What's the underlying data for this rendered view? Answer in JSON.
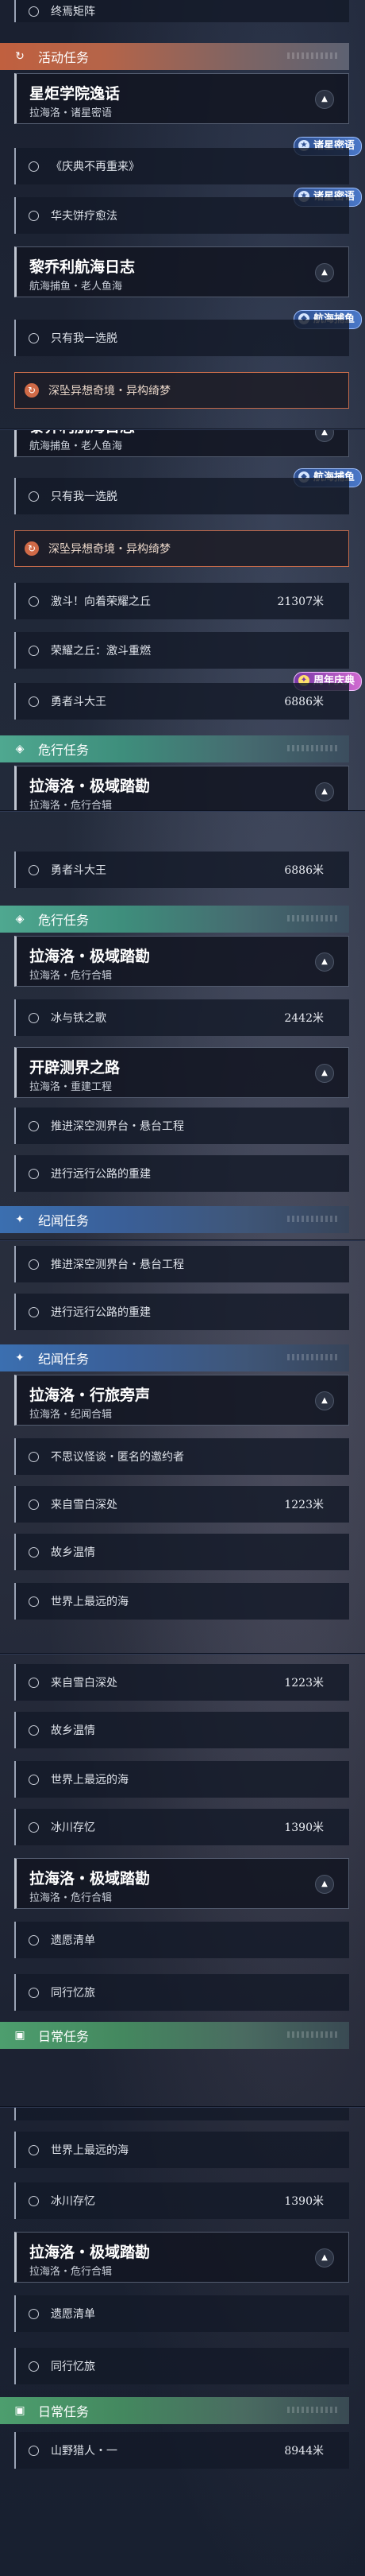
{
  "sections": {
    "activity": "活动任务",
    "danger": "危行任务",
    "chronicle": "纪闻任务",
    "daily": "日常任务"
  },
  "quests": {
    "top_partial": "终焉矩阵",
    "xingju": {
      "title": "星炬学院逸话",
      "subtitle": "拉海洛・诸星密语"
    },
    "qingdian": "《庆典不再重来》",
    "huafu": "华夫饼疗愈法",
    "liqiao": {
      "title": "黎乔利航海日志",
      "subtitle": "航海捕鱼・老人鱼海"
    },
    "zhiyou": "只有我一选脱",
    "shenzhui": "深坠异想奇境・异构绮梦",
    "jidou": "激斗！向着荣耀之丘",
    "rongyao": "荣耀之丘：激斗重燃",
    "yongzhe": "勇者斗大王",
    "jiyu": {
      "title": "拉海洛・极域踏勘",
      "subtitle": "拉海洛・危行合辑"
    },
    "bingyutie": "冰与铁之歌",
    "kaipi": {
      "title": "开辟测界之路",
      "subtitle": "拉海洛・重建工程"
    },
    "tuijin": "推进深空测界台・悬台工程",
    "jinxing": "进行远行公路的重建",
    "xinglv": {
      "title": "拉海洛・行旅旁声",
      "subtitle": "拉海洛・纪闻合辑"
    },
    "busiyi": "不思议怪谈・匿名的邀约者",
    "xueyuan": "来自雪白深处",
    "guxiang": "故乡温情",
    "zuiyuan": "世界上最远的海",
    "bingchuan": "冰川存忆",
    "yiyuan": "遗愿清单",
    "tongxing": "同行忆旅",
    "shanye": "山野猎人・一"
  },
  "distances": {
    "jidou": "21307米",
    "yongzhe": "6886米",
    "bingyutie": "2442米",
    "xueyuan": "1223米",
    "bingchuan": "1390米",
    "shanye": "8944米"
  },
  "badges": {
    "zhuxing": "诸星密语",
    "hanghai": "航海捕鱼",
    "anniversary": "周年庆典"
  },
  "icons": {
    "activity": "spiral-icon",
    "danger": "diamond-icon",
    "chronicle": "sparkle-icon",
    "daily": "calendar-icon",
    "bullet": "circle-icon",
    "collapse": "chevron-up-icon"
  },
  "colors": {
    "activity": "#c0603f",
    "danger": "#4fa890",
    "chronicle": "#3b6fb0",
    "daily": "#4d9e6e",
    "badge": "#3c67b4",
    "anniversary": "#a04fc0"
  }
}
